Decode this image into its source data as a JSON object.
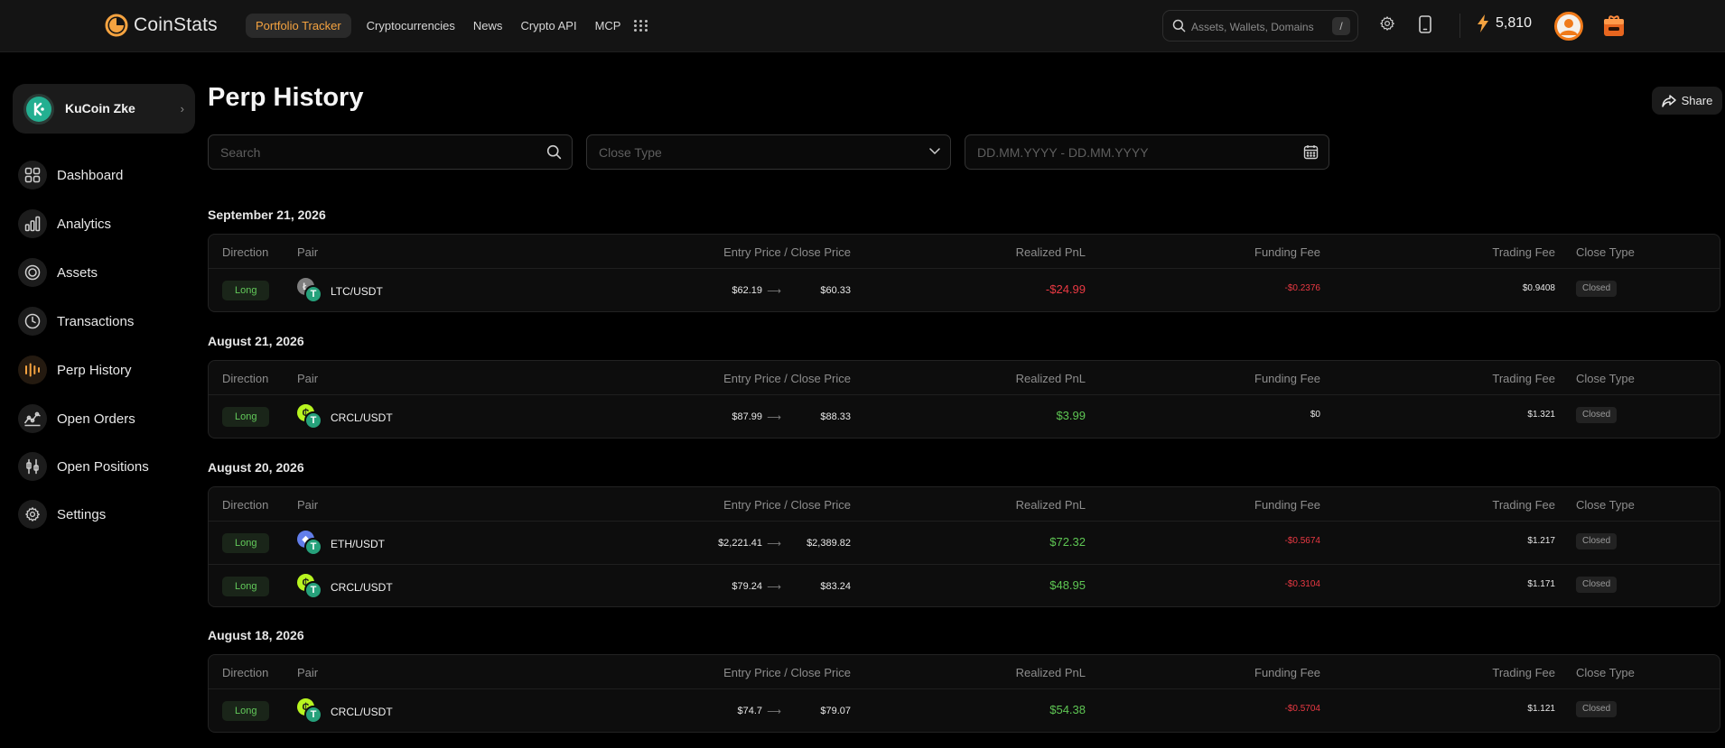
{
  "brand": {
    "name": "CoinStats",
    "accent": "#f5a340"
  },
  "nav": [
    "Portfolio Tracker",
    "Cryptocurrencies",
    "News",
    "Crypto API",
    "MCP"
  ],
  "top_search": {
    "placeholder": "Assets, Wallets, Domains",
    "shortcut": "/"
  },
  "points": "5,810",
  "account": {
    "name": "KuCoin Zke"
  },
  "sidebar": {
    "items": [
      {
        "label": "Dashboard",
        "icon": "dashboard-icon"
      },
      {
        "label": "Analytics",
        "icon": "analytics-icon"
      },
      {
        "label": "Assets",
        "icon": "assets-icon"
      },
      {
        "label": "Transactions",
        "icon": "transactions-icon"
      },
      {
        "label": "Perp History",
        "icon": "perp-history-icon",
        "active": true
      },
      {
        "label": "Open Orders",
        "icon": "open-orders-icon"
      },
      {
        "label": "Open Positions",
        "icon": "open-positions-icon"
      },
      {
        "label": "Settings",
        "icon": "settings-icon"
      }
    ]
  },
  "page": {
    "title": "Perp History",
    "share_label": "Share",
    "filters": {
      "search_placeholder": "Search",
      "close_type_placeholder": "Close Type",
      "date_placeholder": "DD.MM.YYYY - DD.MM.YYYY"
    }
  },
  "columns": {
    "direction": "Direction",
    "pair": "Pair",
    "entry_close": "Entry Price / Close Price",
    "pnl": "Realized PnL",
    "funding": "Funding Fee",
    "trading": "Trading Fee",
    "close_type": "Close Type"
  },
  "colors": {
    "positive": "#5ec653",
    "negative": "#ea3943",
    "long_badge": "#62c95a"
  },
  "groups": [
    {
      "date": "September 21, 2026",
      "rows": [
        {
          "direction": "Long",
          "pair": "LTC/USDT",
          "coin": "ltc",
          "entry": "$62.19",
          "close": "$60.33",
          "pnl": "-$24.99",
          "pnl_sign": "neg",
          "funding": "-$0.2376",
          "funding_sign": "neg",
          "trading": "$0.9408",
          "close_type": "Closed"
        }
      ]
    },
    {
      "date": "August 21, 2026",
      "rows": [
        {
          "direction": "Long",
          "pair": "CRCL/USDT",
          "coin": "crcl",
          "entry": "$87.99",
          "close": "$88.33",
          "pnl": "$3.99",
          "pnl_sign": "pos",
          "funding": "$0",
          "funding_sign": "zero",
          "trading": "$1.321",
          "close_type": "Closed"
        }
      ]
    },
    {
      "date": "August 20, 2026",
      "rows": [
        {
          "direction": "Long",
          "pair": "ETH/USDT",
          "coin": "eth",
          "entry": "$2,221.41",
          "close": "$2,389.82",
          "pnl": "$72.32",
          "pnl_sign": "pos",
          "funding": "-$0.5674",
          "funding_sign": "neg",
          "trading": "$1.217",
          "close_type": "Closed"
        },
        {
          "direction": "Long",
          "pair": "CRCL/USDT",
          "coin": "crcl",
          "entry": "$79.24",
          "close": "$83.24",
          "pnl": "$48.95",
          "pnl_sign": "pos",
          "funding": "-$0.3104",
          "funding_sign": "neg",
          "trading": "$1.171",
          "close_type": "Closed"
        }
      ]
    },
    {
      "date": "August 18, 2026",
      "rows": [
        {
          "direction": "Long",
          "pair": "CRCL/USDT",
          "coin": "crcl",
          "entry": "$74.7",
          "close": "$79.07",
          "pnl": "$54.38",
          "pnl_sign": "pos",
          "funding": "-$0.5704",
          "funding_sign": "neg",
          "trading": "$1.121",
          "close_type": "Closed"
        }
      ]
    }
  ]
}
